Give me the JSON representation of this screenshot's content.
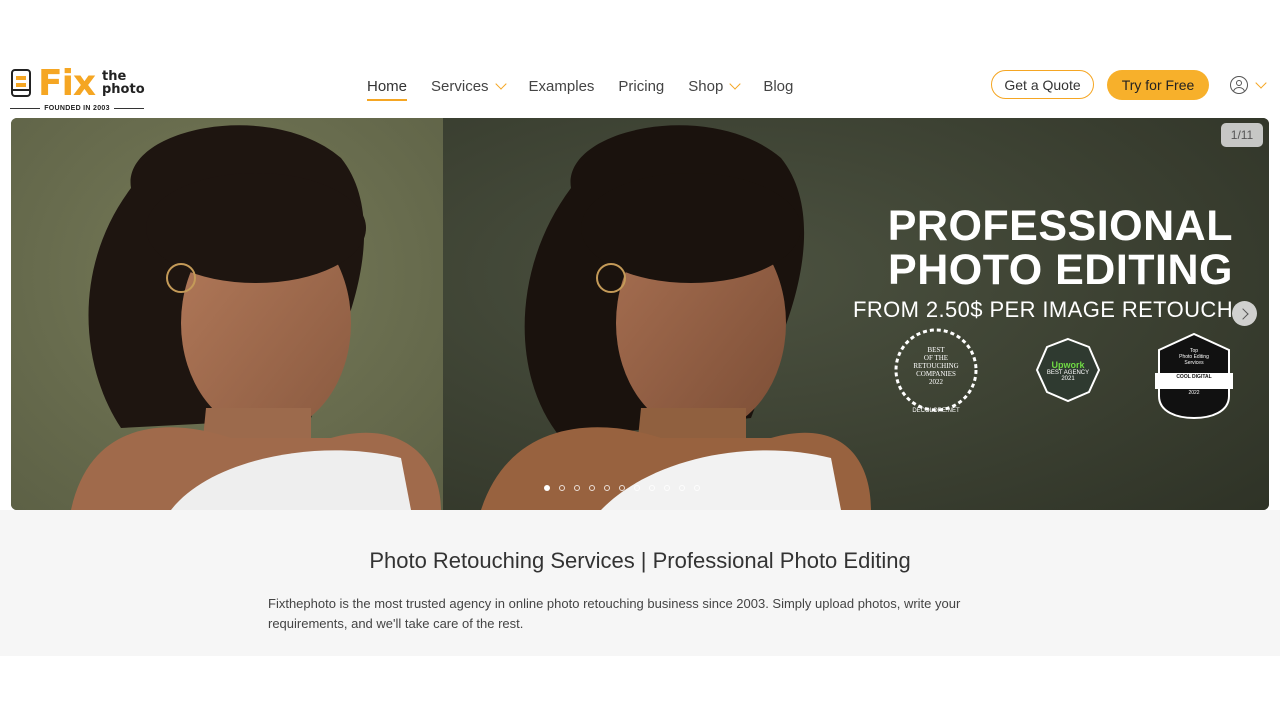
{
  "logo": {
    "word": "Fix",
    "the": "the",
    "photo": "photo",
    "tagline": "FOUNDED IN 2003"
  },
  "nav": {
    "items": [
      {
        "label": "Home",
        "active": true,
        "dropdown": false
      },
      {
        "label": "Services",
        "active": false,
        "dropdown": true
      },
      {
        "label": "Examples",
        "active": false,
        "dropdown": false
      },
      {
        "label": "Pricing",
        "active": false,
        "dropdown": false
      },
      {
        "label": "Shop",
        "active": false,
        "dropdown": true
      },
      {
        "label": "Blog",
        "active": false,
        "dropdown": false
      }
    ]
  },
  "actions": {
    "quote_label": "Get a Quote",
    "try_label": "Try for Free"
  },
  "colors": {
    "accent": "#f5a623",
    "accent_fill": "#f7b02b",
    "hero_bg_left": "#6a6e4e",
    "hero_bg_right": "#363b2c"
  },
  "hero": {
    "counter": "1/11",
    "title_line1": "PROFESSIONAL",
    "title_line2": "PHOTO EDITING",
    "subtitle": "FROM 2.50$ PER IMAGE RETOUCH",
    "badges": {
      "laurel": {
        "line1": "BEST",
        "line2": "OF THE",
        "line3": "RETOUCHING",
        "line4": "COMPANIES",
        "year": "2022",
        "source": "DECOLORE.NET"
      },
      "upwork": {
        "brand": "Upwork",
        "line1": "BEST AGENCY",
        "year": "2021"
      },
      "cool": {
        "line1": "Top",
        "line2": "Photo Editing",
        "line3": "Services",
        "brand": "COOL DIGITAL",
        "year": "2022"
      }
    },
    "slide_count": 11,
    "active_slide": 1
  },
  "intro": {
    "title": "Photo Retouching Services | Professional Photo Editing",
    "body": "Fixthephoto is the most trusted agency in online photo retouching business since 2003. Simply upload photos, write your requirements, and we'll take care of the rest."
  }
}
